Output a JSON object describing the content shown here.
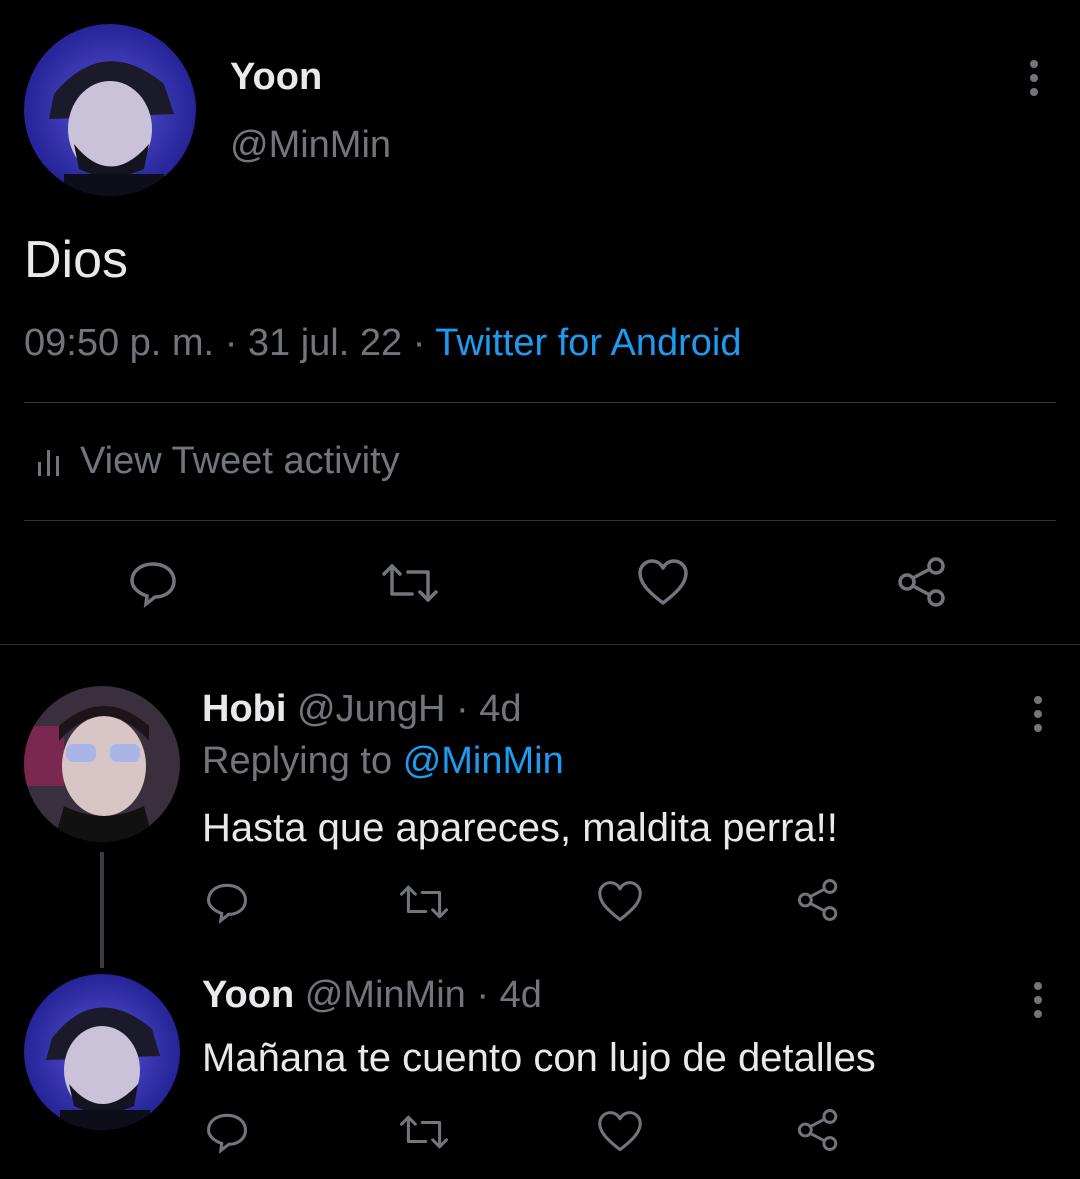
{
  "main_tweet": {
    "display_name": "Yoon",
    "handle": "@MinMin",
    "text": "Dios",
    "time": "09:50 p. m.",
    "sep1": "·",
    "date": "31 jul. 22",
    "sep2": "·",
    "source": "Twitter for Android",
    "activity_label": "View Tweet activity"
  },
  "replies": [
    {
      "display_name": "Hobi",
      "handle": "@JungH",
      "sep": "·",
      "age": "4d",
      "replying_prefix": "Replying to",
      "replying_handle": "@MinMin",
      "text": "Hasta que apareces, maldita perra!!"
    },
    {
      "display_name": "Yoon",
      "handle": "@MinMin",
      "sep": "·",
      "age": "4d",
      "text": "Mañana te cuento con lujo de detalles"
    }
  ],
  "colors": {
    "background": "#000000",
    "text": "#e7e9ea",
    "muted": "#71767b",
    "link": "#1d9bf0",
    "divider": "#2f3336"
  },
  "icons": [
    "reply-icon",
    "retweet-icon",
    "like-icon",
    "share-icon",
    "more-icon",
    "bar-chart-icon"
  ]
}
